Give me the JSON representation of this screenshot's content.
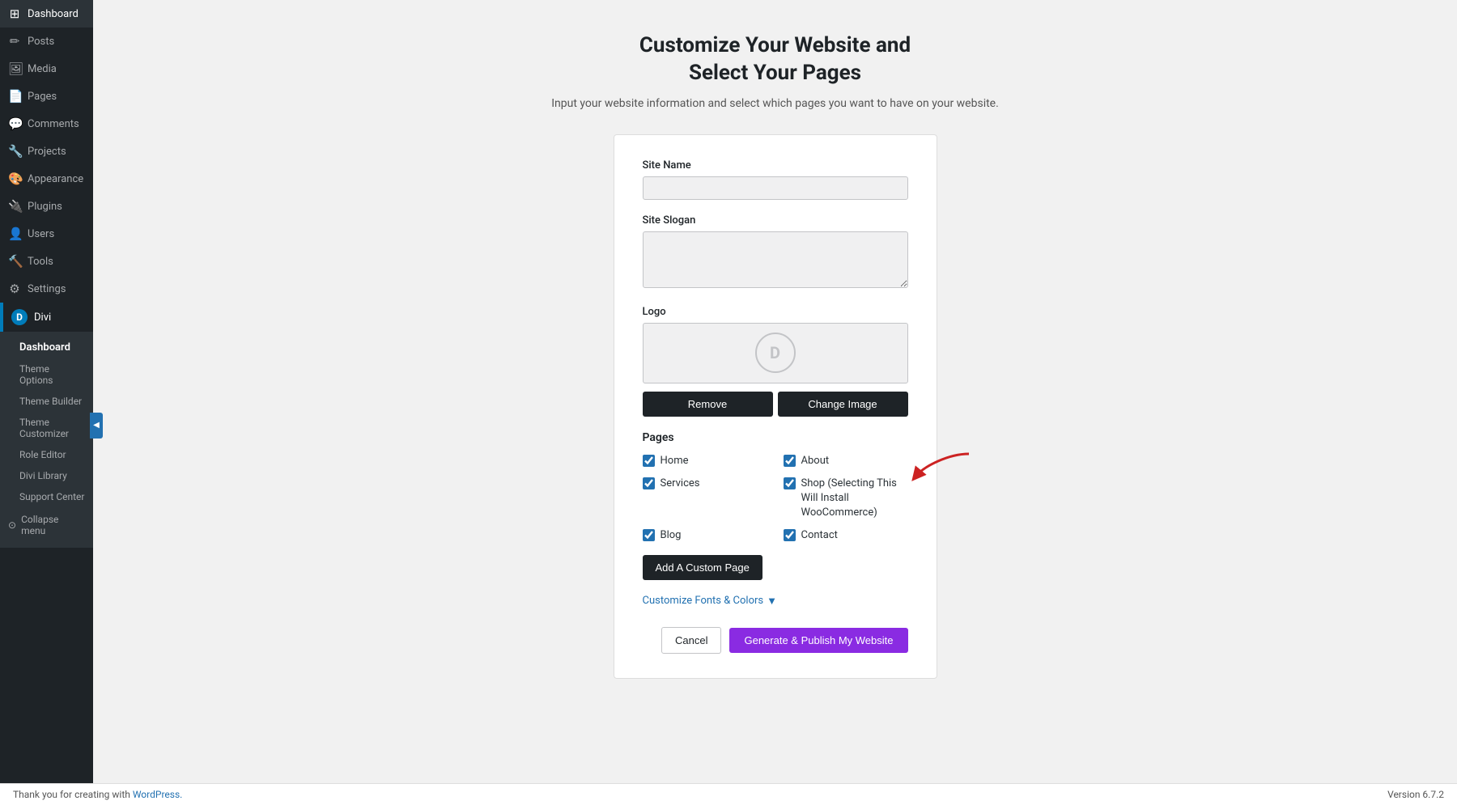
{
  "sidebar": {
    "items": [
      {
        "id": "dashboard",
        "label": "Dashboard",
        "icon": "⊞"
      },
      {
        "id": "posts",
        "label": "Posts",
        "icon": "📝"
      },
      {
        "id": "media",
        "label": "Media",
        "icon": "🖼"
      },
      {
        "id": "pages",
        "label": "Pages",
        "icon": "📄"
      },
      {
        "id": "comments",
        "label": "Comments",
        "icon": "💬"
      },
      {
        "id": "projects",
        "label": "Projects",
        "icon": "🔧"
      },
      {
        "id": "appearance",
        "label": "Appearance",
        "icon": "🎨"
      },
      {
        "id": "plugins",
        "label": "Plugins",
        "icon": "🔌"
      },
      {
        "id": "users",
        "label": "Users",
        "icon": "👤"
      },
      {
        "id": "tools",
        "label": "Tools",
        "icon": "🔨"
      },
      {
        "id": "settings",
        "label": "Settings",
        "icon": "⚙"
      }
    ],
    "divi": {
      "label": "Divi",
      "icon": "D",
      "submenu": [
        {
          "id": "dashboard",
          "label": "Dashboard"
        },
        {
          "id": "theme-options",
          "label": "Theme Options"
        },
        {
          "id": "theme-builder",
          "label": "Theme Builder"
        },
        {
          "id": "theme-customizer",
          "label": "Theme Customizer"
        },
        {
          "id": "role-editor",
          "label": "Role Editor"
        },
        {
          "id": "divi-library",
          "label": "Divi Library"
        },
        {
          "id": "support-center",
          "label": "Support Center"
        }
      ],
      "collapse_label": "Collapse menu"
    }
  },
  "main": {
    "title_line1": "Customize Your Website and",
    "title_line2": "Select Your Pages",
    "subtitle": "Input your website information and select which pages you want to have on your website.",
    "form": {
      "site_name_label": "Site Name",
      "site_name_value": "",
      "site_slogan_label": "Site Slogan",
      "site_slogan_value": "",
      "logo_label": "Logo",
      "logo_icon": "D",
      "remove_btn": "Remove",
      "change_image_btn": "Change Image",
      "pages_label": "Pages",
      "pages": [
        {
          "id": "home",
          "label": "Home",
          "checked": true,
          "col": 1
        },
        {
          "id": "about",
          "label": "About",
          "checked": true,
          "col": 2
        },
        {
          "id": "services",
          "label": "Services",
          "checked": true,
          "col": 1
        },
        {
          "id": "shop",
          "label": "Shop (Selecting This Will Install WooCommerce)",
          "checked": true,
          "col": 2
        },
        {
          "id": "blog",
          "label": "Blog",
          "checked": true,
          "col": 1
        },
        {
          "id": "contact",
          "label": "Contact",
          "checked": true,
          "col": 2
        }
      ],
      "add_custom_page_btn": "Add A Custom Page",
      "customize_link": "Customize Fonts & Colors",
      "customize_link_icon": "▼",
      "cancel_btn": "Cancel",
      "publish_btn": "Generate & Publish My Website"
    }
  },
  "footer": {
    "text": "Thank you for creating with",
    "link_text": "WordPress.",
    "version": "Version 6.7.2"
  }
}
